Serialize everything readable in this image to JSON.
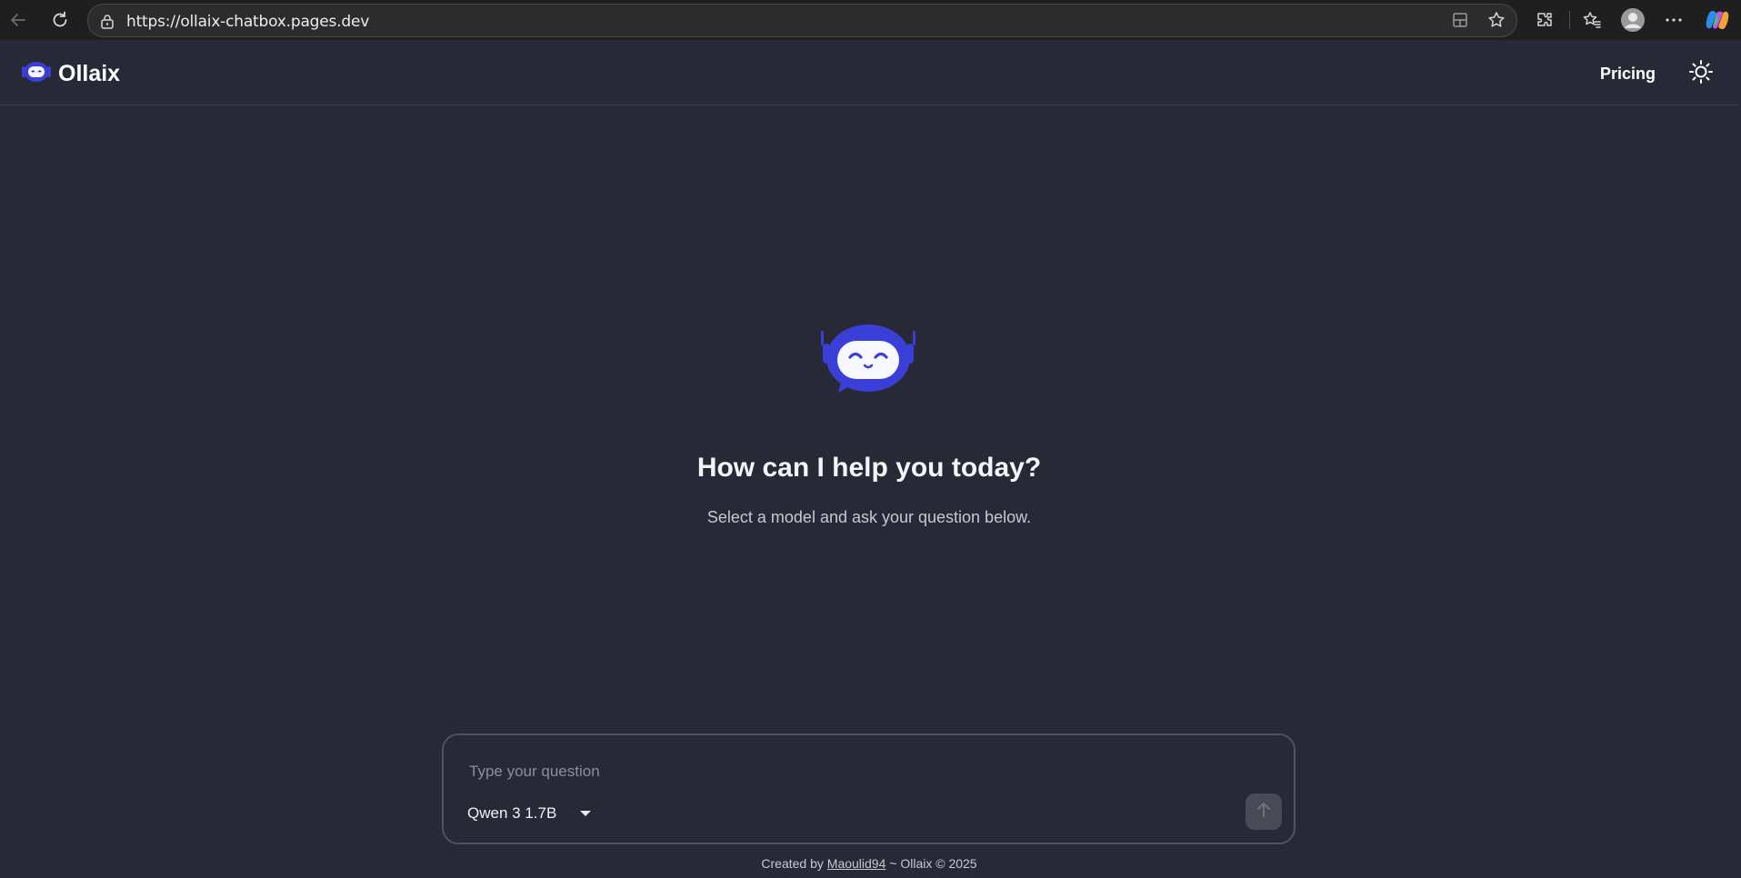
{
  "browser": {
    "url": "https://ollaix-chatbox.pages.dev"
  },
  "header": {
    "brand": "Ollaix",
    "pricing_label": "Pricing"
  },
  "hero": {
    "title": "How can I help you today?",
    "subtitle": "Select a model and ask your question below."
  },
  "chat": {
    "placeholder": "Type your question",
    "model": "Qwen 3 1.7B"
  },
  "footer": {
    "prefix": "Created by",
    "author": "Maoulid94",
    "suffix": "~ Ollaix © 2025"
  },
  "colors": {
    "background": "#272a36",
    "accent": "#3a3fd8",
    "browser_chrome": "#1f1f1f"
  }
}
